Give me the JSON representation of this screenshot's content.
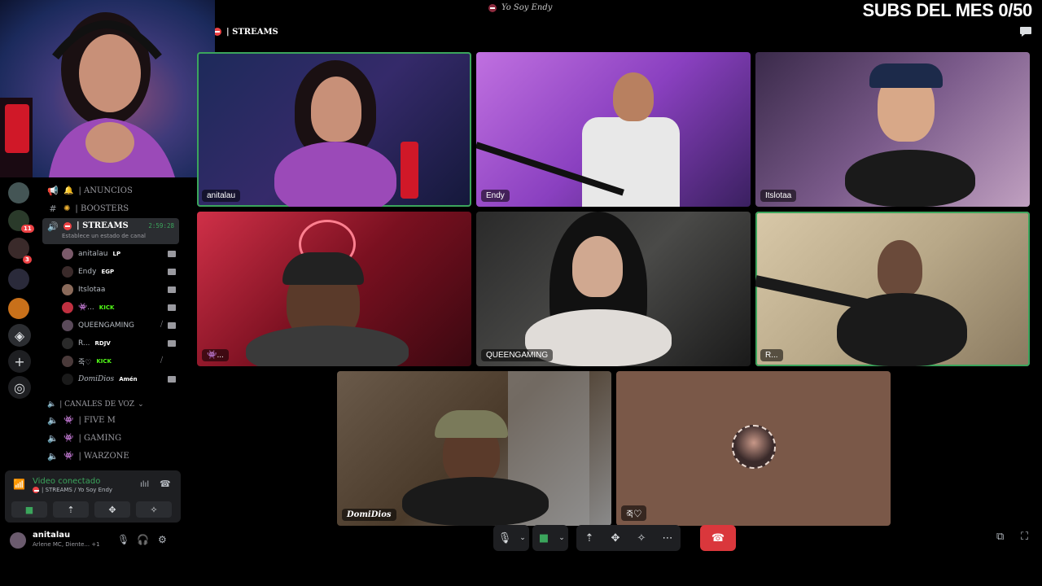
{
  "top_bar": {
    "title": "Yo Soy Endy",
    "subs_counter": "SUBS DEL MES 0/50"
  },
  "header": {
    "channel": "| STREAMS"
  },
  "channels": {
    "anuncios": "| ANUNCIOS",
    "boosters": "| BOOSTERS",
    "streams": "| STREAMS",
    "streams_status": "Establece un estado de canal",
    "streams_timer": "2:59:28",
    "members": [
      {
        "name": "anitalau",
        "tag": "LP"
      },
      {
        "name": "Endy",
        "tag": "EGP"
      },
      {
        "name": "Itslotaa",
        "tag": ""
      },
      {
        "name": "👾...",
        "tag": "KICK"
      },
      {
        "name": "QUEENGAMING",
        "tag": ""
      },
      {
        "name": "R...",
        "tag": "RDJV"
      },
      {
        "name": "죽♡",
        "tag": "KICK"
      },
      {
        "name": "DomiDios",
        "tag": "Amén"
      }
    ],
    "voice_category": "| CANALES DE VOZ",
    "voice_channels": [
      "| FIVE M",
      "| GAMING",
      "| WARZONE"
    ]
  },
  "rail": {
    "badges": [
      "11",
      "3",
      "3"
    ]
  },
  "voice_panel": {
    "status": "Video conectado",
    "channel": "| STREAMS / Yo Soy Endy"
  },
  "user_panel": {
    "name": "anitalau",
    "activity": "Arlene MC, Diente... +1"
  },
  "tiles": {
    "t1": "anitalau",
    "t2": "Endy",
    "t3": "Itslotaa",
    "t4": "👾...",
    "t5": "QUEENGAMING",
    "t6": "R...",
    "t7": "DomiDios",
    "t8": "죽♡"
  },
  "colors": {
    "speaking": "#3ba55c",
    "end_call": "#da373c",
    "accent_green": "#3ba55c"
  },
  "icons": [
    "chat-icon",
    "mic-icon",
    "camera-icon",
    "screenshare-icon",
    "activities-icon",
    "soundboard-icon",
    "more-icon",
    "hangup-icon",
    "popout-icon",
    "fullscreen-icon"
  ]
}
